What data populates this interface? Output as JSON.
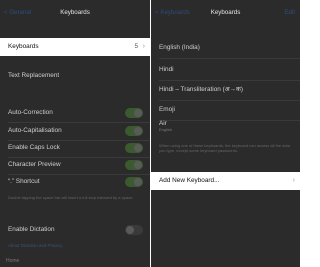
{
  "left": {
    "back_label": "< General",
    "title": "Keyboards",
    "keyboards_row": {
      "label": "Keyboards",
      "count": "5"
    },
    "text_replacement": "Text Replacement",
    "toggles": [
      {
        "label": "Auto-Correction",
        "on": true
      },
      {
        "label": "Auto-Capitalisation",
        "on": true
      },
      {
        "label": "Enable Caps Lock",
        "on": true
      },
      {
        "label": "Character Preview",
        "on": true
      },
      {
        "label": "“.” Shortcut",
        "on": true
      }
    ],
    "shortcut_note": "Double tapping the space bar will insert a full stop followed by a space.",
    "enable_dictation": {
      "label": "Enable Dictation",
      "on": false
    },
    "dictation_link": "About Dictation and Privacy...",
    "home": "Home"
  },
  "right": {
    "back_label": "< Keyboards",
    "title": "Keyboards",
    "edit_label": "Edit",
    "keyboards": [
      {
        "label": "English (India)"
      },
      {
        "label": "Hindi"
      },
      {
        "label": "Hindi – Transliteration (अ→क)"
      },
      {
        "label": "Emoji"
      },
      {
        "label": "Air",
        "sub": "English"
      }
    ],
    "note": "When using one of these keyboards, the keyboard can access all the data you type, except some keyboard passwords.",
    "add_new": "Add New Keyboard..."
  },
  "colors": {
    "accent": "#2d4d79",
    "toggle_on": "#3b5a30",
    "background": "#2b2b2b",
    "highlight": "#ffffff"
  }
}
